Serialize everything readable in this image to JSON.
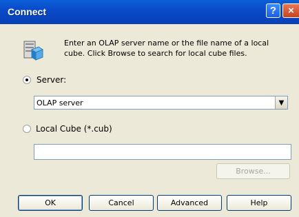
{
  "window": {
    "title": "Connect",
    "help_label": "?",
    "close_label": "×"
  },
  "intro": {
    "text": "Enter an OLAP server name or the file name of a local cube. Click Browse to search for local cube files."
  },
  "server": {
    "label": "Server:",
    "selected": true,
    "value": "OLAP server"
  },
  "local_cube": {
    "label": "Local Cube (*.cub)",
    "selected": false,
    "value": ""
  },
  "buttons": {
    "browse": "Browse...",
    "ok": "OK",
    "cancel": "Cancel",
    "advanced": "Advanced",
    "help": "Help"
  },
  "icons": {
    "arrow": "▼"
  }
}
